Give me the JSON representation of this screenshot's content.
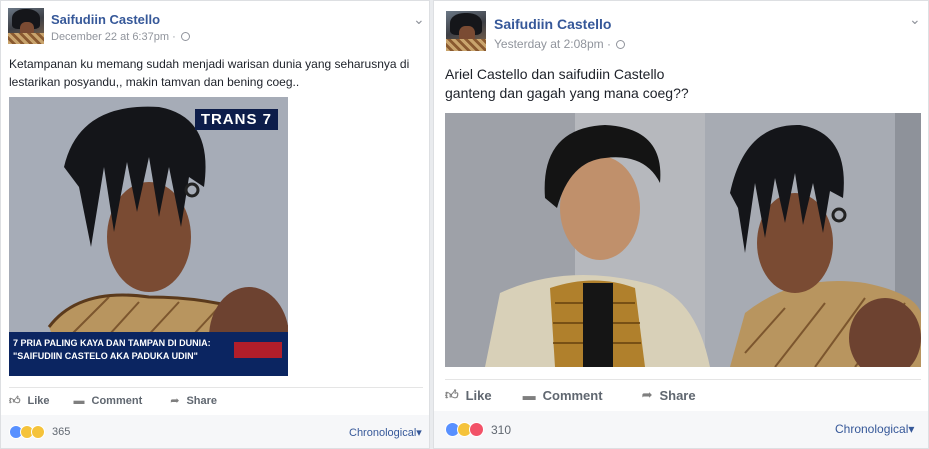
{
  "left_post": {
    "author": "Saifudiin Castello",
    "timestamp": "December 22 at 6:37pm",
    "text": "Ketampanan ku memang sudah menjadi warisan dunia yang seharusnya di lestarikan posyandu,, makin tamvan dan bening coeg..",
    "image": {
      "channel_logo": "TRANS 7",
      "caption_line1": "7 PRIA PALING KAYA DAN TAMPAN DI DUNIA:",
      "caption_line2": "\"SAIFUDIIN CASTELO AKA PADUKA UDIN\""
    },
    "actions": {
      "like": "Like",
      "comment": "Comment",
      "share": "Share"
    },
    "reaction_count": "365",
    "sort_label": "Chronological"
  },
  "right_post": {
    "author": "Saifudiin Castello",
    "timestamp": "Yesterday at 2:08pm",
    "text_line1": "Ariel Castello dan saifudiin Castello",
    "text_line2": "ganteng dan gagah yang mana coeg??",
    "actions": {
      "like": "Like",
      "comment": "Comment",
      "share": "Share"
    },
    "reaction_count": "310",
    "sort_label": "Chronological"
  },
  "colors": {
    "link": "#365899",
    "muted": "#90949c",
    "like_blue": "#5890ff"
  },
  "icons": [
    "chevron-down-icon",
    "globe-icon",
    "like-icon",
    "comment-icon",
    "share-icon",
    "caret-down-icon"
  ]
}
